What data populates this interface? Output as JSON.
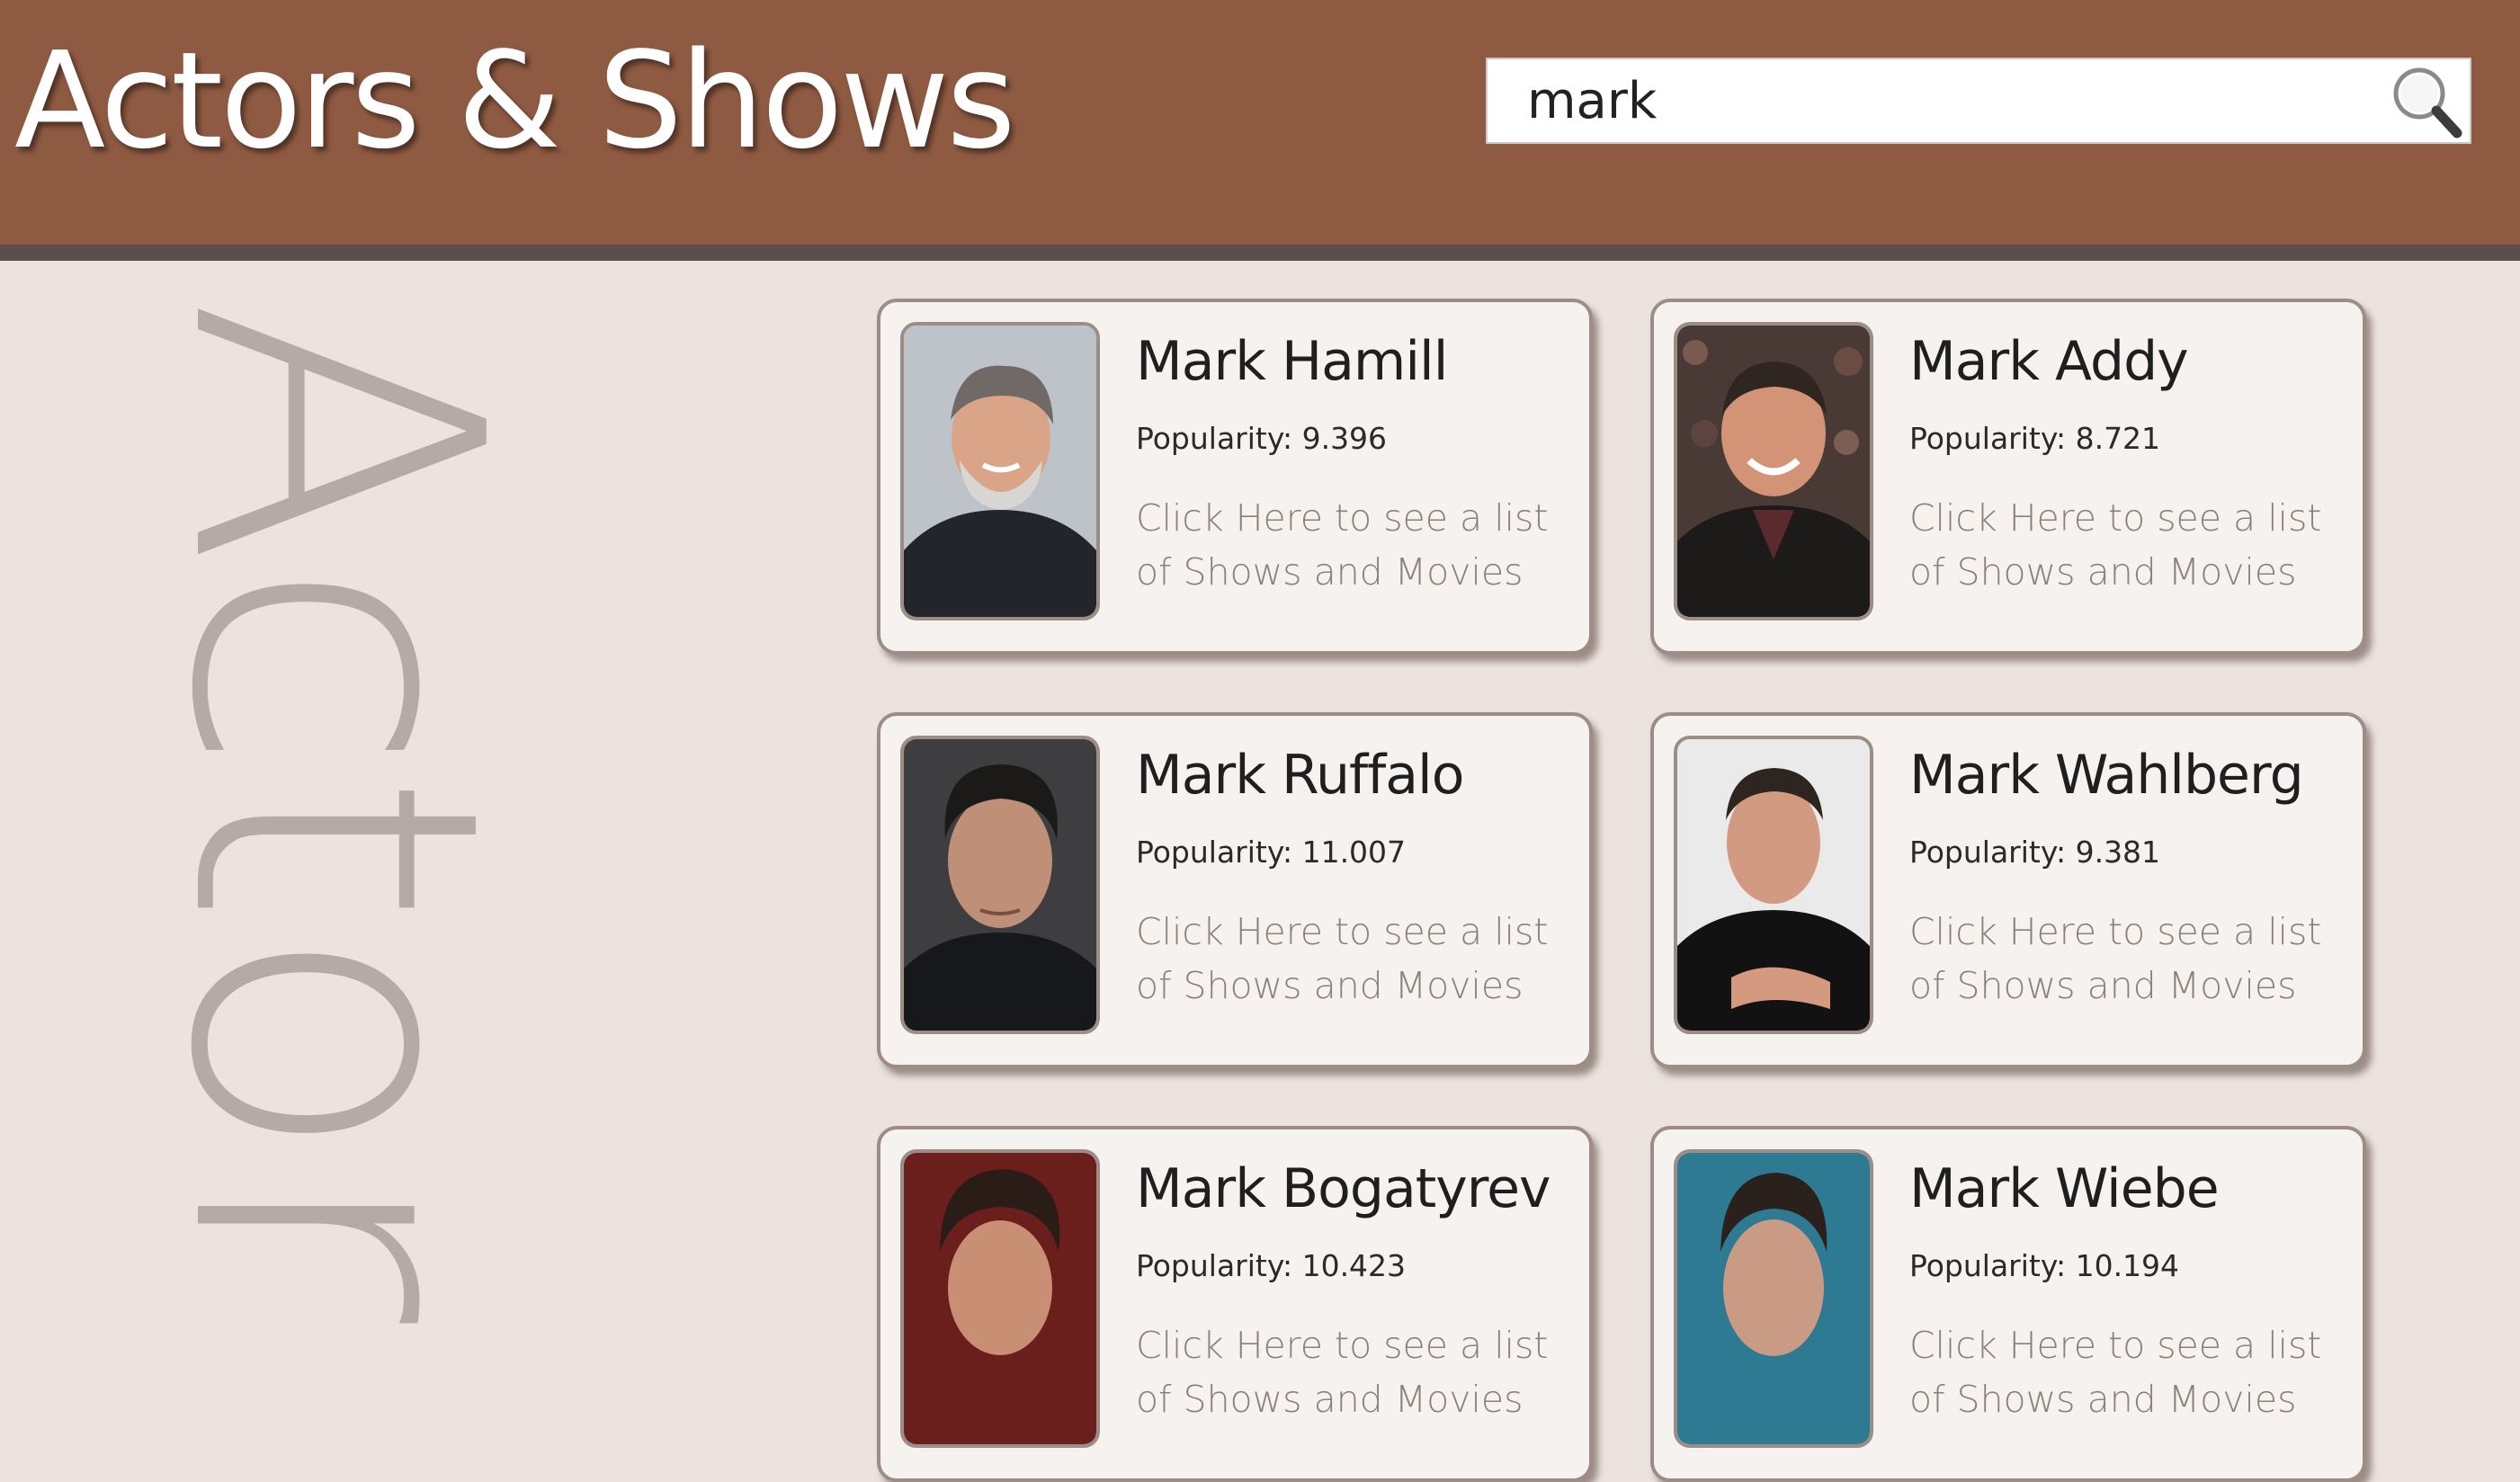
{
  "header": {
    "title": "Actors & Shows",
    "search_value": "mark"
  },
  "section_label": "Actor",
  "popularity_prefix": "Popularity: ",
  "link_text": "Click Here to see a list of Shows and Movies",
  "colors": {
    "header_bg": "#8f5a42",
    "header_border": "#5a4f4c",
    "page_bg": "#ece3df",
    "card_bg": "#f6f2f0",
    "card_border": "#9c8d87",
    "link_text": "#8a807c",
    "vertical_label": "#b5aaa5"
  },
  "actors": [
    {
      "name": "Mark Hamill",
      "popularity": "9.396"
    },
    {
      "name": "Mark Addy",
      "popularity": "8.721"
    },
    {
      "name": "Mark Ruffalo",
      "popularity": "11.007"
    },
    {
      "name": "Mark Wahlberg",
      "popularity": "9.381"
    },
    {
      "name": "Mark Bogatyrev",
      "popularity": "10.423"
    },
    {
      "name": "Mark Wiebe",
      "popularity": "10.194"
    }
  ]
}
